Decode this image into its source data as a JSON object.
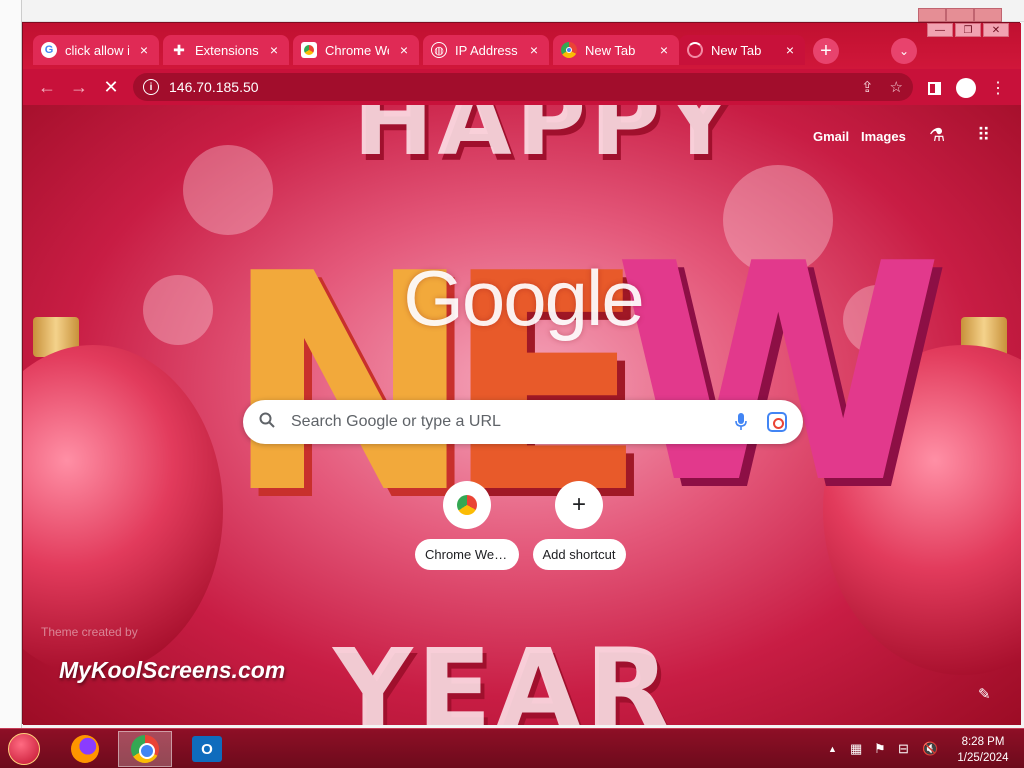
{
  "browser": {
    "tabs": [
      {
        "label": "click allow it",
        "favicon": "google-icon",
        "active": false
      },
      {
        "label": "Extensions",
        "favicon": "puzzle-icon",
        "active": false
      },
      {
        "label": "Chrome Web",
        "favicon": "webstore-icon",
        "active": false
      },
      {
        "label": "IP Address",
        "favicon": "globe-icon",
        "active": false
      },
      {
        "label": "New Tab",
        "favicon": "chrome-icon",
        "active": false
      },
      {
        "label": "New Tab",
        "favicon": "loading-icon",
        "active": true
      }
    ],
    "close_glyph": "×",
    "new_tab_glyph": "+",
    "tab_search_glyph": "⌄",
    "window_controls": {
      "minimize": "—",
      "restore": "❐",
      "close": "✕"
    }
  },
  "toolbar": {
    "back_glyph": "←",
    "forward_glyph": "→",
    "stop_glyph": "✕",
    "url": "146.70.185.50",
    "info_glyph": "i"
  },
  "ntp": {
    "gmail_label": "Gmail",
    "images_label": "Images",
    "search_placeholder": "Search Google or type a URL",
    "logo_text": "Google",
    "decor": {
      "top": "HAPPY",
      "middle": "NEW",
      "bottom": "YEAR"
    },
    "shortcuts": [
      {
        "label": "Chrome Web ...",
        "icon": "webstore-icon"
      },
      {
        "label": "Add shortcut",
        "icon": "plus-icon",
        "glyph": "+"
      }
    ],
    "theme_credit": "Theme created by",
    "theme_name": "MyKoolScreens.com",
    "customize_glyph": "✎"
  },
  "taskbar": {
    "apps": [
      "firefox-icon",
      "chrome-icon",
      "outlook-icon"
    ],
    "outlook_glyph": "O",
    "time": "8:28 PM",
    "date": "1/25/2024",
    "show_hidden_glyph": "▲"
  },
  "colors": {
    "accent": "#c8113a",
    "tab": "#e02a55",
    "google_blue": "#4285f4"
  }
}
